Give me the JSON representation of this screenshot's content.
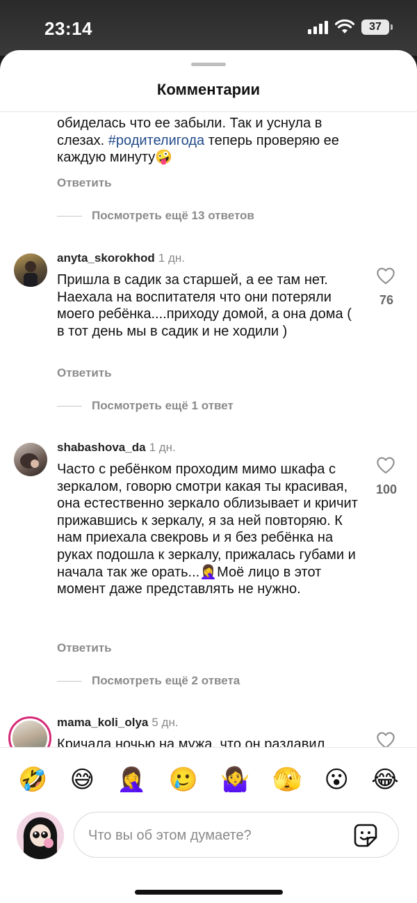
{
  "status_bar": {
    "time": "23:14",
    "battery": "37"
  },
  "sheet": {
    "title": "Комментарии"
  },
  "top_comment": {
    "text_before": "обиделась что ее забыли. Так и уснула в слезах. ",
    "hashtag": "#родителигода",
    "text_after": " теперь проверяю ее каждую минуту🤪",
    "reply_label": "Ответить",
    "more_replies": "Посмотреть ещё 13 ответов"
  },
  "comments": [
    {
      "username": "anyta_skorokhod",
      "ago": "1 дн.",
      "text": "Пришла в садик за старшей, а ее там нет. Наехала на воспитателя что они потеряли моего ребёнка....приходу домой, а она дома ( в тот день мы в садик и не ходили )",
      "likes": "76",
      "reply_label": "Ответить",
      "more_replies": "Посмотреть ещё 1 ответ"
    },
    {
      "username": "shabashova_da",
      "ago": "1 дн.",
      "text": "Часто с ребёнком проходим мимо шкафа с зеркалом, говорю смотри какая ты красивая, она естественно зеркало облизывает и кричит прижавшись к зеркалу, я за ней повторяю. К нам приехала свекровь и я без ребёнка на руках подошла к зеркалу, прижалась губами и начала так же орать...🤦‍♀️Моё лицо в этот момент даже представлять не нужно.",
      "likes": "100",
      "reply_label": "Ответить",
      "more_replies": "Посмотреть ещё 2 ответа"
    },
    {
      "username": "mama_koli_olya",
      "ago": "5 дн.",
      "text": "Кричала ночью на мужа, что он раздавил"
    }
  ],
  "emoji_bar": [
    "🤣",
    "😅",
    "🤦‍♀️",
    "🥲",
    "🤷‍♀️",
    "🫣",
    "😮",
    "😂"
  ],
  "composer": {
    "placeholder": "Что вы об этом думаете?"
  },
  "colors": {
    "hashtag": "#224a8a",
    "muted": "#8a8a8a",
    "story_ring": "#d62976"
  },
  "icons": [
    "signal-icon",
    "wifi-icon",
    "battery-icon",
    "heart-icon",
    "sticker-icon"
  ]
}
